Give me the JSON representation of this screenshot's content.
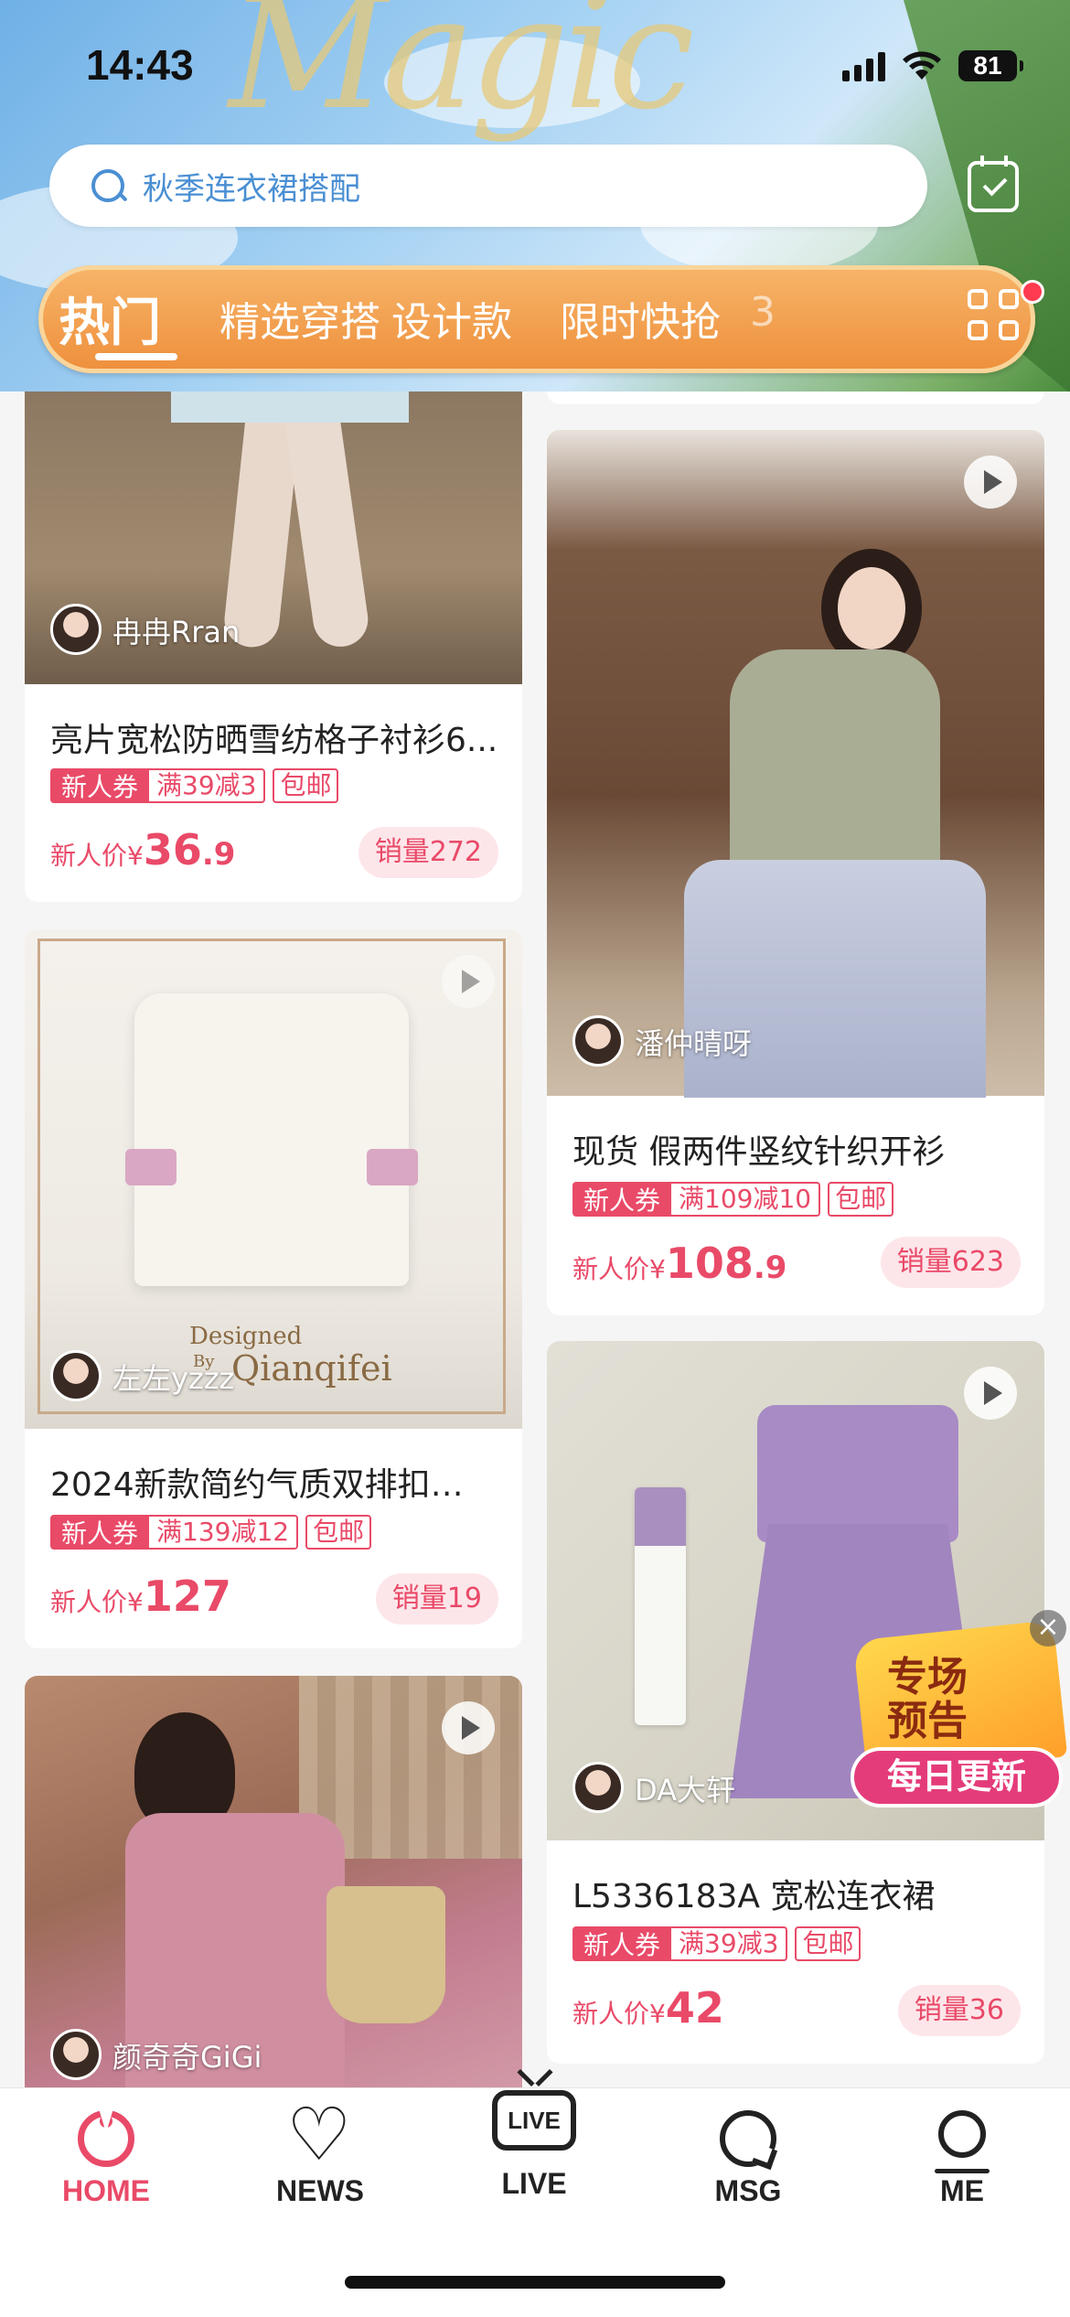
{
  "status_bar": {
    "time": "14:43",
    "battery": "81"
  },
  "search": {
    "placeholder": "秋季连衣裙搭配"
  },
  "tabs": [
    {
      "label": "热门",
      "active": true
    },
    {
      "label": "精选穿搭"
    },
    {
      "label": "设计款"
    },
    {
      "label": "限时快抢"
    },
    {
      "label": "3"
    }
  ],
  "left_column": [
    {
      "user": "冉冉Rran",
      "title": "亮片宽松防晒雪纺格子衬衫6...",
      "tag_new": "新人券",
      "tag_cut": "满39减3",
      "tag_ship": "包邮",
      "price_label": "新人价¥",
      "price_int": "36",
      "price_dec": ".9",
      "sales": "销量272"
    },
    {
      "user": "左左yzzz",
      "watermark_line1": "Designed",
      "watermark_line2": "By",
      "watermark_line3": "Qianqifei",
      "title": "2024新款简约气质双排扣…",
      "tag_new": "新人券",
      "tag_cut": "满139减12",
      "tag_ship": "包邮",
      "price_label": "新人价¥",
      "price_int": "127",
      "price_dec": "",
      "sales": "销量19"
    },
    {
      "user": "颜奇奇GiGi"
    }
  ],
  "right_column": [
    {
      "user": "潘仲晴呀",
      "title": "现货 假两件竖纹针织开衫",
      "tag_new": "新人券",
      "tag_cut": "满109减10",
      "tag_ship": "包邮",
      "price_label": "新人价¥",
      "price_int": "108",
      "price_dec": ".9",
      "sales": "销量623"
    },
    {
      "user": "DA大轩",
      "title": "L5336183A 宽松连衣裙",
      "tag_new": "新人券",
      "tag_cut": "满39减3",
      "tag_ship": "包邮",
      "price_label": "新人价¥",
      "price_int": "42",
      "price_dec": "",
      "sales": "销量36"
    }
  ],
  "promo": {
    "line1": "专场",
    "line2": "预告",
    "pill": "每日更新",
    "close": "×"
  },
  "bottom_nav": [
    {
      "label": "HOME",
      "icon": "home-icon",
      "active": true
    },
    {
      "label": "NEWS",
      "icon": "heart-icon"
    },
    {
      "label": "LIVE",
      "icon": "live-tv-icon",
      "badge": "LIVE"
    },
    {
      "label": "MSG",
      "icon": "message-icon"
    },
    {
      "label": "ME",
      "icon": "profile-icon"
    }
  ],
  "colors": {
    "accent": "#e94a68",
    "tab_orange": "#ee8f3b",
    "search_blue": "#4a8fd3"
  }
}
